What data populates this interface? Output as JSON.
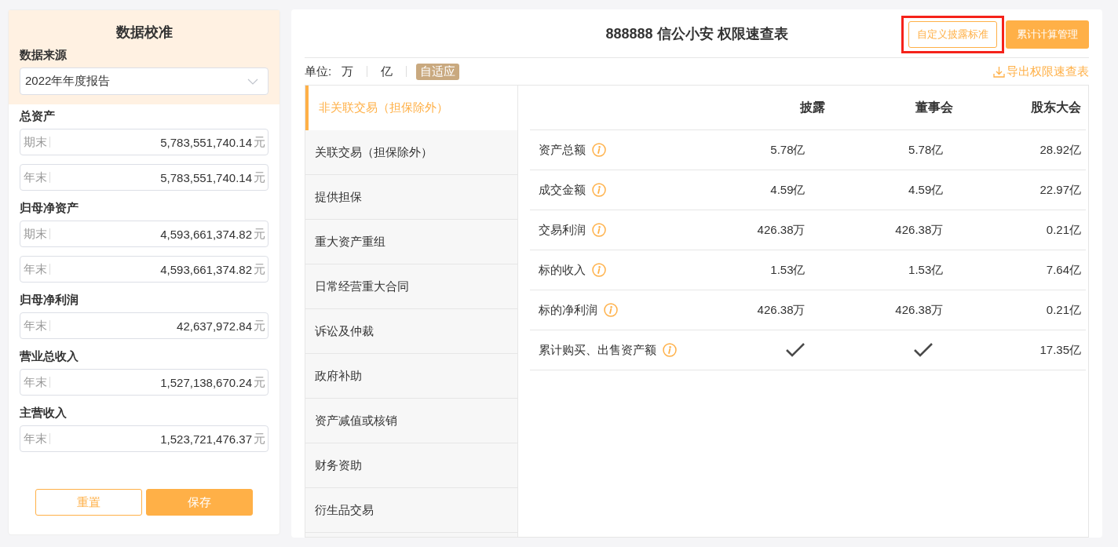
{
  "calibration": {
    "title": "数据校准",
    "source_label": "数据来源",
    "source_value": "2022年年度报告",
    "sections": [
      {
        "label": "总资产",
        "fields": [
          {
            "prefix": "期末",
            "value": "5,783,551,740.14",
            "unit": "元"
          },
          {
            "prefix": "年末",
            "value": "5,783,551,740.14",
            "unit": "元"
          }
        ]
      },
      {
        "label": "归母净资产",
        "fields": [
          {
            "prefix": "期末",
            "value": "4,593,661,374.82",
            "unit": "元"
          },
          {
            "prefix": "年末",
            "value": "4,593,661,374.82",
            "unit": "元"
          }
        ]
      },
      {
        "label": "归母净利润",
        "fields": [
          {
            "prefix": "年末",
            "value": "42,637,972.84",
            "unit": "元"
          }
        ]
      },
      {
        "label": "营业总收入",
        "fields": [
          {
            "prefix": "年末",
            "value": "1,527,138,670.24",
            "unit": "元"
          }
        ]
      },
      {
        "label": "主营收入",
        "fields": [
          {
            "prefix": "年末",
            "value": "1,523,721,476.37",
            "unit": "元"
          }
        ]
      }
    ],
    "buttons": {
      "reset": "重置",
      "save": "保存"
    }
  },
  "main": {
    "title": "888888 信公小安 权限速查表",
    "custom_button": "自定义披露标准",
    "cumulative_button": "累计计算管理",
    "unit_label": "单位:",
    "units": [
      {
        "label": "万",
        "selected": false
      },
      {
        "label": "亿",
        "selected": false
      },
      {
        "label": "自适应",
        "selected": true
      }
    ],
    "export_link": "导出权限速查表",
    "categories": [
      {
        "label": "非关联交易（担保除外）",
        "selected": true
      },
      {
        "label": "关联交易（担保除外）",
        "selected": false
      },
      {
        "label": "提供担保",
        "selected": false
      },
      {
        "label": "重大资产重组",
        "selected": false
      },
      {
        "label": "日常经营重大合同",
        "selected": false
      },
      {
        "label": "诉讼及仲裁",
        "selected": false
      },
      {
        "label": "政府补助",
        "selected": false
      },
      {
        "label": "资产减值或核销",
        "selected": false
      },
      {
        "label": "财务资助",
        "selected": false
      },
      {
        "label": "衍生品交易",
        "selected": false
      }
    ],
    "table": {
      "columns": [
        "披露",
        "董事会",
        "股东大会"
      ],
      "rows": [
        {
          "name": "资产总额",
          "cells": [
            {
              "kind": "text",
              "text": "5.78亿"
            },
            {
              "kind": "text",
              "text": "5.78亿"
            },
            {
              "kind": "text",
              "text": "28.92亿"
            }
          ]
        },
        {
          "name": "成交金额",
          "cells": [
            {
              "kind": "text",
              "text": "4.59亿"
            },
            {
              "kind": "text",
              "text": "4.59亿"
            },
            {
              "kind": "text",
              "text": "22.97亿"
            }
          ]
        },
        {
          "name": "交易利润",
          "cells": [
            {
              "kind": "text",
              "text": "426.38万"
            },
            {
              "kind": "text",
              "text": "426.38万"
            },
            {
              "kind": "text",
              "text": "0.21亿"
            }
          ]
        },
        {
          "name": "标的收入",
          "cells": [
            {
              "kind": "text",
              "text": "1.53亿"
            },
            {
              "kind": "text",
              "text": "1.53亿"
            },
            {
              "kind": "text",
              "text": "7.64亿"
            }
          ]
        },
        {
          "name": "标的净利润",
          "cells": [
            {
              "kind": "text",
              "text": "426.38万"
            },
            {
              "kind": "text",
              "text": "426.38万"
            },
            {
              "kind": "text",
              "text": "0.21亿"
            }
          ]
        },
        {
          "name": "累计购买、出售资产额",
          "cells": [
            {
              "kind": "check"
            },
            {
              "kind": "check"
            },
            {
              "kind": "text",
              "text": "17.35亿"
            }
          ]
        }
      ]
    }
  }
}
